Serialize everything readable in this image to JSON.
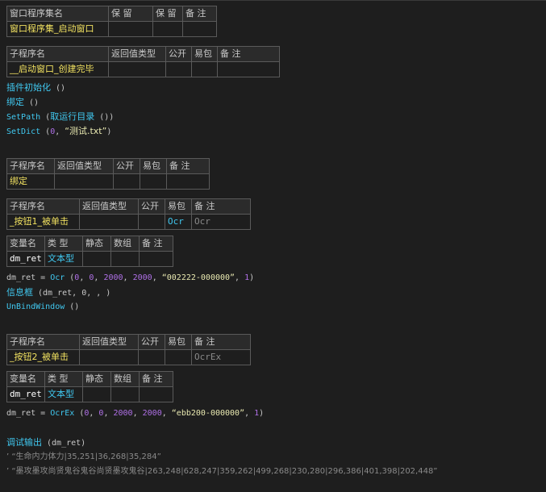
{
  "t1": {
    "h": [
      "窗口程序集名",
      "保 留",
      "保 留",
      "备 注"
    ],
    "r": [
      "窗口程序集_启动窗口",
      "",
      "",
      ""
    ]
  },
  "t2": {
    "h": [
      "子程序名",
      "返回值类型",
      "公开",
      "易包",
      "备 注"
    ],
    "r": [
      "__启动窗口_创建完毕",
      "",
      "",
      "",
      ""
    ]
  },
  "code1": [
    {
      "f": "插件初始化",
      "rest": " ()"
    },
    {
      "f": "绑定",
      "rest": " ()"
    },
    {
      "f": "SetPath",
      "a": " (",
      "f2": "取运行目录",
      "rest": " ())"
    },
    {
      "f": "SetDict",
      "a": " (",
      "n": "0",
      "b": ", ",
      "s": "“测试.txt”",
      "rest": ")"
    }
  ],
  "t3": {
    "h": [
      "子程序名",
      "返回值类型",
      "公开",
      "易包",
      "备 注"
    ],
    "r": [
      "绑定",
      "",
      "",
      "",
      ""
    ]
  },
  "t4": {
    "h": [
      "子程序名",
      "返回值类型",
      "公开",
      "易包",
      "备 注"
    ],
    "r": [
      "_按钮1_被单击",
      "",
      "",
      "Ocr",
      "Ocr"
    ]
  },
  "t5": {
    "h": [
      "变量名",
      "类 型",
      "静态",
      "数组",
      "备 注"
    ],
    "r": [
      "dm_ret",
      "文本型",
      "",
      "",
      ""
    ]
  },
  "code2": {
    "l1": {
      "v": "dm_ret",
      "eq": " = ",
      "f": "Ocr",
      "a": " (",
      "n1": "0",
      "c1": ", ",
      "n2": "0",
      "c2": ", ",
      "n3": "2000",
      "c3": ", ",
      "n4": "2000",
      "c4": ", ",
      "s": "“002222-000000”",
      "c5": ", ",
      "n5": "1",
      "e": ")"
    },
    "l2": {
      "f": "信息框",
      "rest": " (dm_ret, 0, , )"
    },
    "l3": {
      "f": "UnBindWindow",
      "rest": " ()"
    }
  },
  "t6": {
    "h": [
      "子程序名",
      "返回值类型",
      "公开",
      "易包",
      "备 注"
    ],
    "r": [
      "_按钮2_被单击",
      "",
      "",
      "",
      "OcrEx"
    ]
  },
  "t7": {
    "h": [
      "变量名",
      "类 型",
      "静态",
      "数组",
      "备 注"
    ],
    "r": [
      "dm_ret",
      "文本型",
      "",
      "",
      ""
    ]
  },
  "code3": {
    "l1": {
      "v": "dm_ret",
      "eq": " = ",
      "f": "OcrEx",
      "a": " (",
      "n1": "0",
      "c1": ", ",
      "n2": "0",
      "c2": ", ",
      "n3": "2000",
      "c3": ", ",
      "n4": "2000",
      "c4": ", ",
      "s": "“ebb200-000000”",
      "c5": ", ",
      "n5": "1",
      "e": ")"
    },
    "l2": {
      "f": "调试输出",
      "rest": " (dm_ret)"
    },
    "l3": "’ “生命内力体力|35,251|36,268|35,284”",
    "l4": "’ “墨攻墨攻尚贤鬼谷鬼谷尚贤墨攻鬼谷|263,248|628,247|359,262|499,268|230,280|296,386|401,398|202,448”"
  },
  "colors": {
    "bg": "#1e1e1e",
    "func": "#40c8f0",
    "string": "#e8e8b0",
    "number": "#b070e8",
    "comment": "#8a8a8a",
    "name": "#f0e060"
  }
}
